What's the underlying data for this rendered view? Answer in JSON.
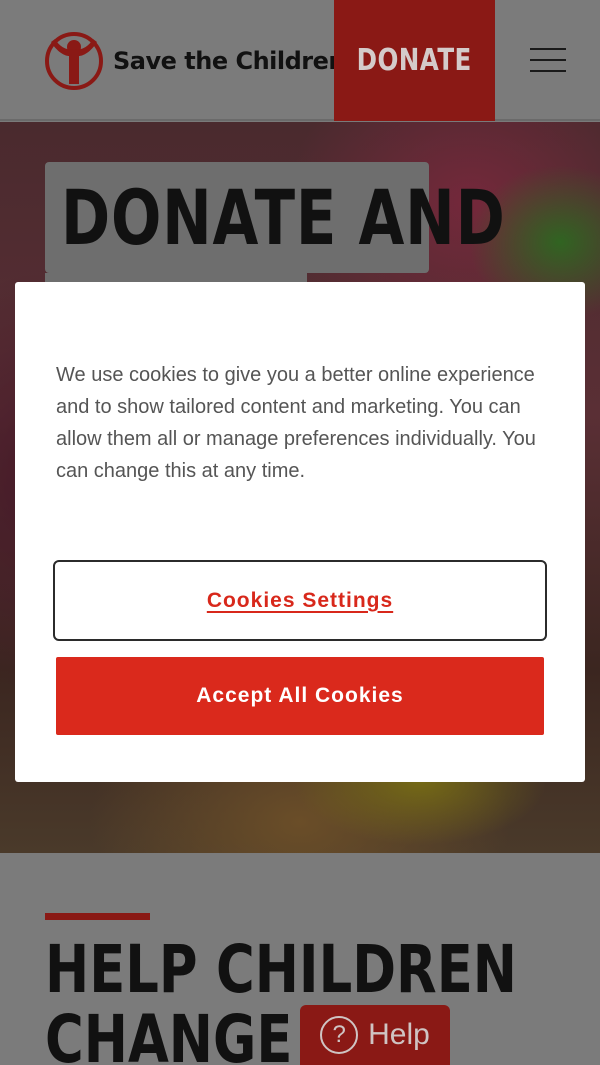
{
  "header": {
    "logo_text": "Save the Children",
    "donate_label": "DONATE",
    "menu_icon": "hamburger-icon"
  },
  "hero": {
    "title": "DONATE AND"
  },
  "cookie_modal": {
    "message": "We use cookies to give you a better online experience and to show tailored content and marketing. You can allow them all or manage preferences individually. You can change this at any time.",
    "settings_label": "Cookies Settings",
    "accept_label": "Accept All Cookies"
  },
  "section": {
    "title_line1": "HELP CHILDREN",
    "title_line2": "CHANGE TH"
  },
  "help_widget": {
    "icon": "question-circle-icon",
    "icon_glyph": "?",
    "label": "Help"
  },
  "colors": {
    "brand_red": "#da291c",
    "dim_red": "#8a1915"
  }
}
